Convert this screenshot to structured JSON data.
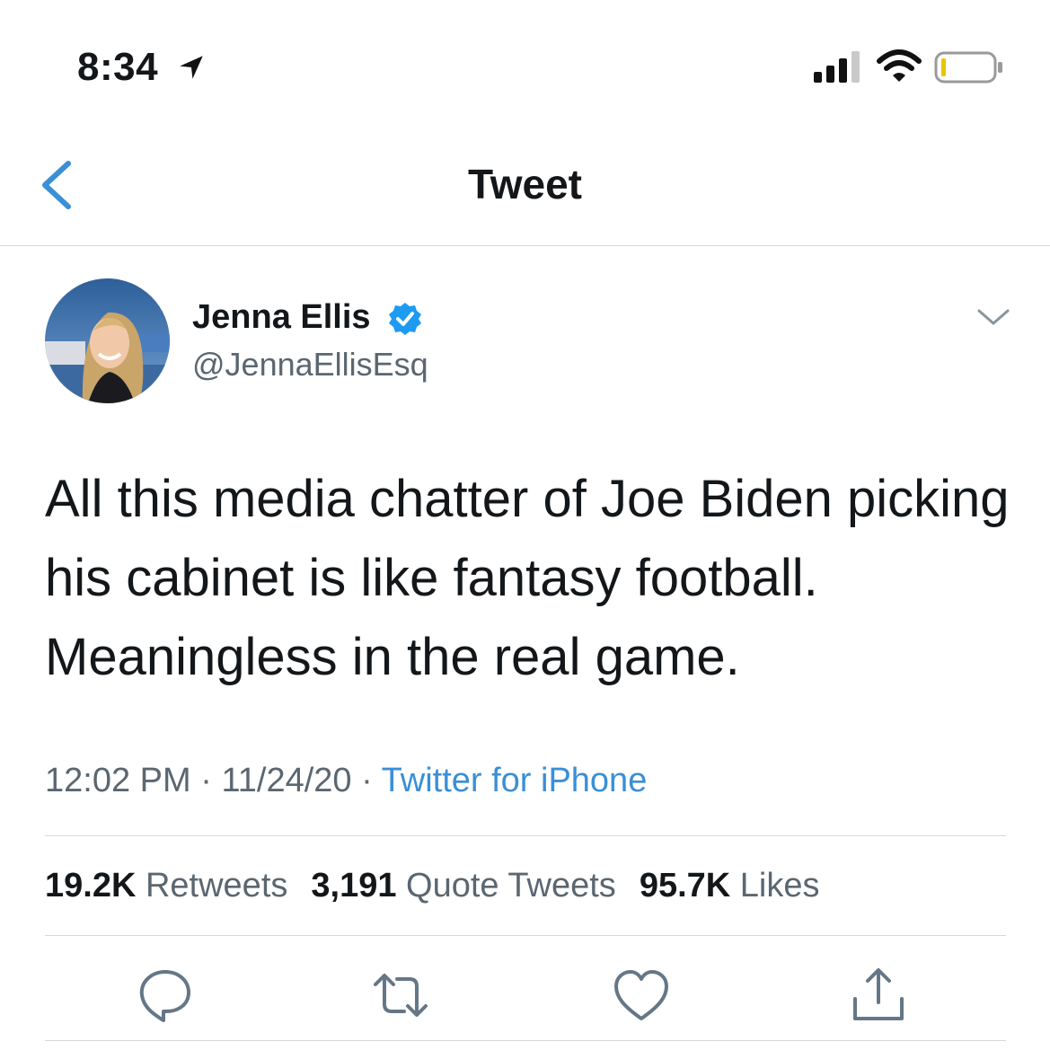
{
  "status_bar": {
    "time": "8:34",
    "icons": [
      "location-arrow-icon",
      "cellular-signal-icon",
      "wifi-icon",
      "battery-icon"
    ]
  },
  "nav": {
    "title": "Tweet",
    "back_icon": "chevron-left-icon"
  },
  "tweet": {
    "author_name": "Jenna Ellis",
    "handle": "@JennaEllisEsq",
    "verified": true,
    "text": "All this media chatter of Joe Biden picking his cabinet is like fantasy football. Meaningless in the real game.",
    "time": "12:02 PM",
    "date": "11/24/20",
    "source": "Twitter for iPhone",
    "separator": " · "
  },
  "stats": {
    "retweets_count": "19.2K",
    "retweets_label": "Retweets",
    "quotes_count": "3,191",
    "quotes_label": "Quote Tweets",
    "likes_count": "95.7K",
    "likes_label": "Likes"
  },
  "actions": [
    "reply-icon",
    "retweet-icon",
    "like-icon",
    "share-icon"
  ],
  "colors": {
    "accent": "#3a8fd6",
    "text": "#14171a",
    "secondary": "#5b6670",
    "divider": "#d6d9dc",
    "verified": "#1d9bf0"
  }
}
